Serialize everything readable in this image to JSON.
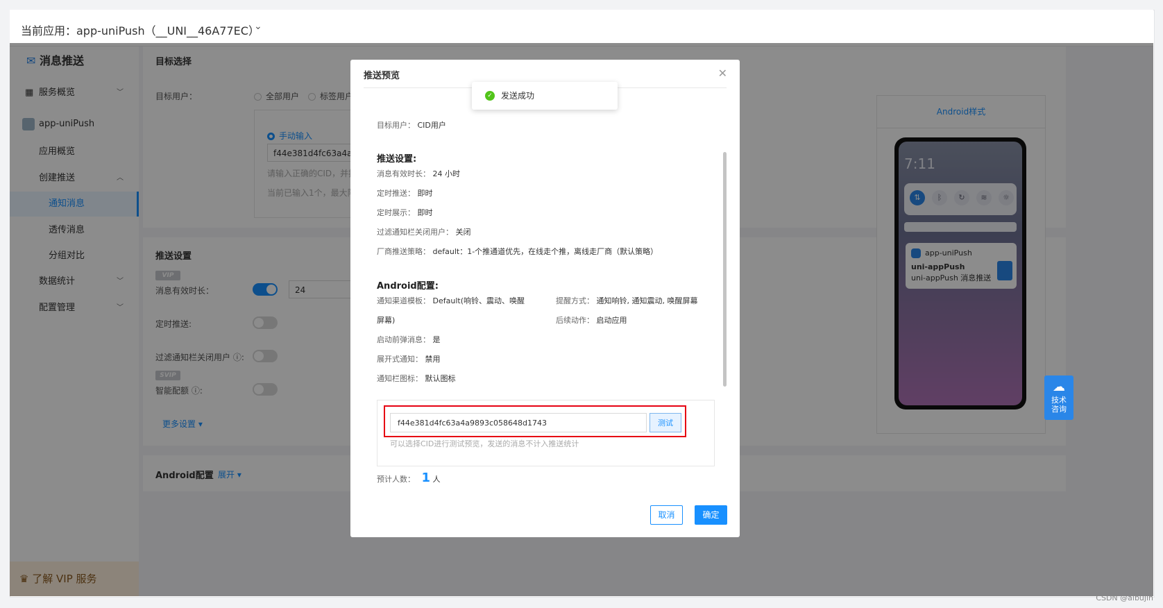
{
  "topbar": {
    "app_label": "当前应用：app-uniPush（__UNI__46A77EC）"
  },
  "sidebar": {
    "title": "消息推送",
    "items": [
      {
        "label": "服务概览"
      },
      {
        "label": "app-uniPush"
      },
      {
        "label": "应用概览"
      },
      {
        "label": "创建推送"
      },
      {
        "label": "通知消息"
      },
      {
        "label": "透传消息"
      },
      {
        "label": "分组对比"
      },
      {
        "label": "数据统计"
      },
      {
        "label": "配置管理"
      }
    ],
    "vip": "了解 VIP 服务"
  },
  "content": {
    "target_title": "目标选择",
    "target_user_label": "目标用户：",
    "target_options": [
      "全部用户",
      "标签用户"
    ],
    "manual_input": "手动输入",
    "cid_value": "f44e381d4fc63a4a98",
    "cid_hint": "请输入正确的CID，并按",
    "cid_count": "当前已输入1个，最大限制",
    "push_settings_title": "推送设置",
    "vip_tag": "VIP",
    "svip_tag": "SVIP",
    "validity_label": "消息有效时长：",
    "validity_value": "24",
    "timed_label": "定时推送:",
    "filter_label": "过滤通知栏关闭用户 ⓘ:",
    "smart_label": "智能配额 ⓘ:",
    "more_settings": "更多设置 ▾",
    "android_title": "Android配置",
    "expand": "展开 ▾"
  },
  "preview": {
    "style_label": "Android样式",
    "time": "7:11",
    "app_name": "app-uniPush",
    "notif_title": "uni-appPush",
    "notif_body": "uni-appPush 消息推送"
  },
  "floater": {
    "label": "技术咨询"
  },
  "modal": {
    "title": "推送预览",
    "target_user_key": "目标用户：",
    "target_user_val": "CID用户",
    "push_settings_head": "推送设置:",
    "validity_key": "消息有效时长：",
    "validity_val": "24 小时",
    "timed_key": "定时推送：",
    "timed_val": "即时",
    "timed_show_key": "定时展示：",
    "timed_show_val": "即时",
    "filter_key": "过滤通知栏关闭用户：",
    "filter_val": "关闭",
    "vendor_key": "厂商推送策略：",
    "vendor_val": "default：1-个推通道优先，在线走个推，离线走厂商（默认策略）",
    "android_head": "Android配置:",
    "channel_key": "通知渠道模板：",
    "channel_val": "Default(响铃、震动、唤醒",
    "channel_val2": "屏幕)",
    "remind_key": "提醒方式：",
    "remind_val": "通知响铃, 通知震动, 唤醒屏幕",
    "follow_key": "后续动作：",
    "follow_val": "启动应用",
    "popup_key": "启动前弹消息：",
    "popup_val": "是",
    "expand_key": "展开式通知：",
    "expand_val": "禁用",
    "icon_key": "通知栏图标：",
    "icon_val": "默认图标",
    "cid_input": "f44e381d4fc63a4a9893c058648d1743",
    "test_button": "测试",
    "test_hint": "可以选择CID进行测试预览，发送的消息不计入推送统计",
    "estimate_key": "预计人数：",
    "estimate_num": "1",
    "estimate_unit": "人",
    "cancel": "取消",
    "confirm": "确定"
  },
  "toast": {
    "text": "发送成功"
  },
  "watermark": "CSDN @aibujin"
}
